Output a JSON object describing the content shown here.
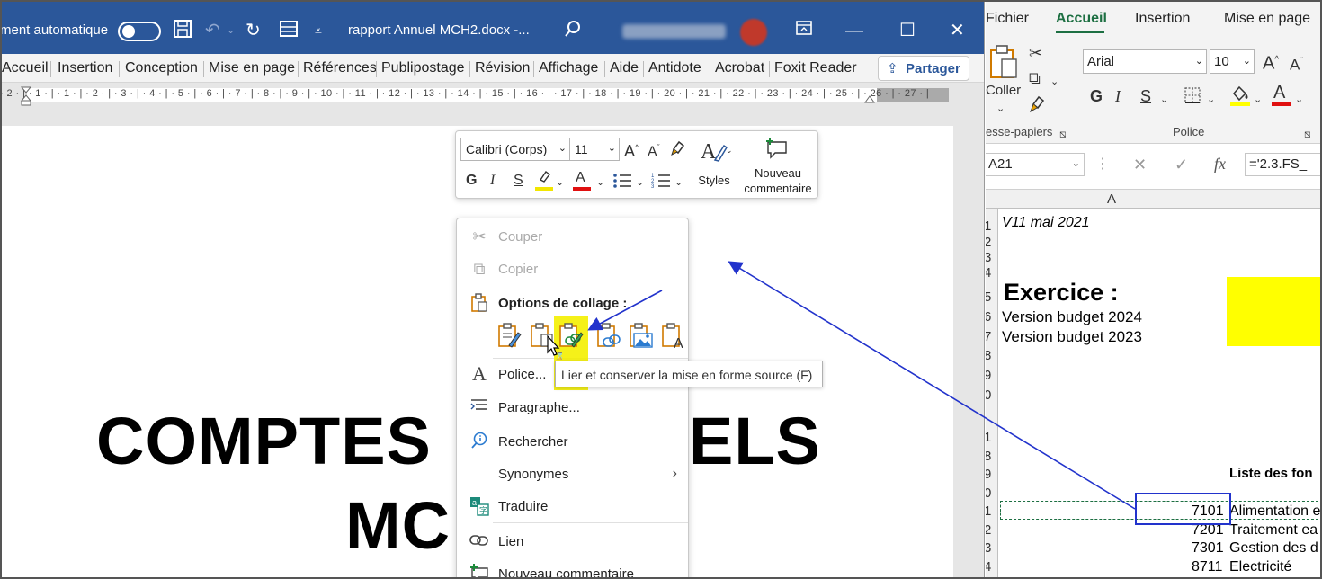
{
  "word": {
    "autosave_label": "ment automatique",
    "doc_title": "rapport Annuel MCH2.docx  -...",
    "tabs": [
      "Accueil",
      "Insertion",
      "Conception",
      "Mise en page",
      "Références",
      "Publipostage",
      "Révision",
      "Affichage",
      "Aide",
      "Antidote",
      "Acrobat",
      "Foxit Reader"
    ],
    "share_label": "Partager",
    "ruler_numbers": "· 2 · | · 1 · | · 1 · | · 2 · | · 3 · | · 4 · | · 5 · | · 6 · | · 7 · | · 8 · | · 9 · | · 10 · | · 11 · | · 12 · | · 13 · | · 14 · | · 15 · | · 16 · | · 17 · | · 18 · | · 19 · | · 20 · | · 21 · | · 22 · | · 23 · | · 24 · | · 25 · | · 26 · | · 27 · |",
    "page_text_line1_left": "COMPTES",
    "page_text_line1_right": "ELS",
    "page_text_line2": "MC"
  },
  "mini_toolbar": {
    "font": "Calibri (Corps)",
    "size": "11",
    "bold": "G",
    "italic": "I",
    "underline": "S",
    "styles_label": "Styles",
    "new_comment_line1": "Nouveau",
    "new_comment_line2": "commentaire",
    "highlight_color": "#f2e600",
    "font_color": "#e01010"
  },
  "context_menu": {
    "cut": "Couper",
    "copy": "Copier",
    "paste_options": "Options de collage :",
    "font": "Police...",
    "paragraph": "Paragraphe...",
    "search": "Rechercher",
    "synonyms": "Synonymes",
    "translate": "Traduire",
    "link": "Lien",
    "new_comment": "Nouveau commentaire"
  },
  "tooltip": "Lier et conserver la mise en forme source (F)",
  "excel": {
    "tabs": [
      "Fichier",
      "Accueil",
      "Insertion",
      "Mise en page"
    ],
    "paste_label": "Coller",
    "clipboard_group": "esse-papiers",
    "font_name": "Arial",
    "font_size": "10",
    "police_group": "Police",
    "name_box": "A21",
    "formula": "='2.3.FS_",
    "fx": "fx",
    "col_a": "A",
    "rows": [
      "1",
      "2",
      "3",
      "4",
      "5",
      "6",
      "7",
      "8",
      "9",
      "0",
      "1",
      "8",
      "9",
      "0",
      "1",
      "2",
      "3",
      "4"
    ],
    "version_text": "V11 mai 2021",
    "exercice": "Exercice :",
    "budget_2024": "Version budget 2024",
    "budget_2023": "Version budget 2023",
    "liste": "Liste des fon",
    "codes": [
      "7101",
      "7201",
      "7301",
      "8711"
    ],
    "labels": [
      "Alimentation e",
      "Traitement ea",
      "Gestion des d",
      "Electricité"
    ]
  }
}
